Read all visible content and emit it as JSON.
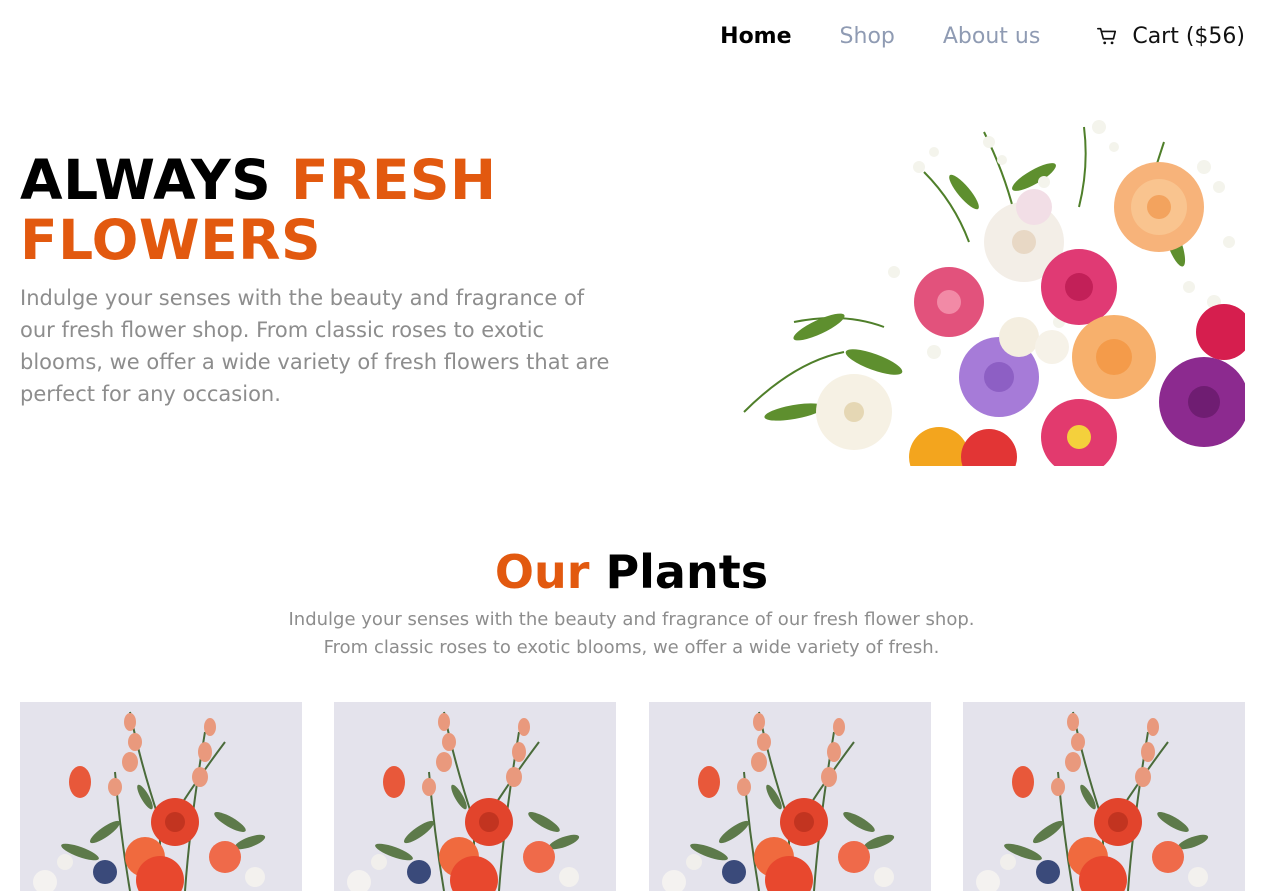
{
  "nav": {
    "items": [
      {
        "label": "Home"
      },
      {
        "label": "Shop"
      },
      {
        "label": "About us"
      }
    ],
    "cart_label": "Cart ($56)",
    "cart_icon": "cart-icon"
  },
  "hero": {
    "title_part1": "ALWAYS ",
    "title_part2": "FRESH FLOWERS",
    "description": "Indulge your senses with the beauty and fragrance of our fresh flower shop. From classic roses to exotic blooms, we offer a wide variety of fresh flowers that are perfect for any occasion."
  },
  "plants": {
    "title_part1": "Our",
    "title_part2": "Plants",
    "description": "Indulge your senses with the beauty and fragrance of our fresh flower shop. From classic roses to exotic blooms, we offer a wide variety of fresh."
  },
  "colors": {
    "accent": "#e2590f",
    "nav_inactive": "#8f9bb3",
    "body_text": "#8d8d8d"
  }
}
